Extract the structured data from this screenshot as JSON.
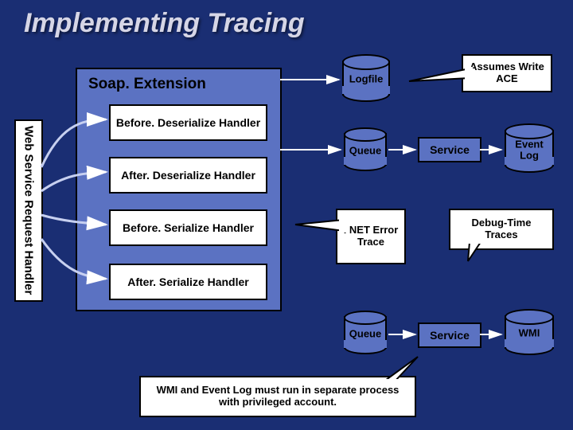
{
  "title": "Implementing Tracing",
  "ws_handler": "Web Service\nRequest Handler",
  "soap_extension": {
    "label": "Soap. Extension",
    "handlers": [
      "Before. Deserialize Handler",
      "After. Deserialize Handler",
      "Before. Serialize Handler",
      "After. Serialize Handler"
    ]
  },
  "cylinders": {
    "logfile": "Logfile",
    "queue1": "Queue",
    "queue2": "Queue",
    "eventlog": "Event Log",
    "wmi": "WMI"
  },
  "services": {
    "svc1": "Service",
    "svc2": "Service"
  },
  "callouts": {
    "assumes": "Assumes Write ACE",
    "nettrace": ". NET Error Trace",
    "debug": "Debug-Time Traces",
    "footnote": "WMI and Event Log must run in separate process with privileged account."
  }
}
